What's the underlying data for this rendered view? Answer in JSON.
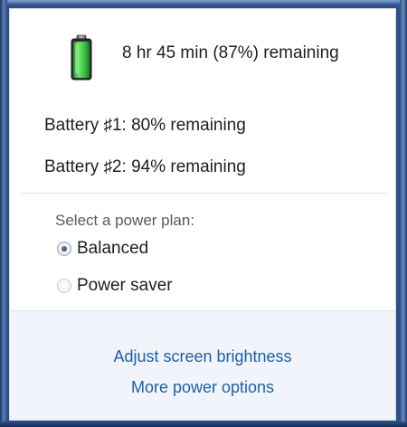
{
  "battery": {
    "summary": "8 hr 45 min (87%) remaining",
    "level_percent": 87,
    "icon": "battery-icon",
    "fill_color": "#2fb53a",
    "items": [
      {
        "label": "Battery ♯1: 80% remaining"
      },
      {
        "label": "Battery ♯2: 94% remaining"
      }
    ]
  },
  "power_plan": {
    "title": "Select a power plan:",
    "options": [
      {
        "label": "Balanced",
        "selected": true
      },
      {
        "label": "Power saver",
        "selected": false
      }
    ]
  },
  "links": {
    "brightness": "Adjust screen brightness",
    "more_options": "More power options",
    "color": "#1f5fa8"
  }
}
